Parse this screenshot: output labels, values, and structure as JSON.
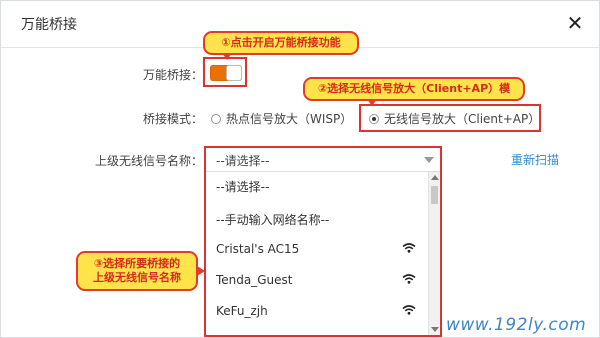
{
  "dialog": {
    "title": "万能桥接",
    "close_glyph": "✕"
  },
  "form": {
    "bridge_label": "万能桥接：",
    "mode_label": "桥接模式：",
    "mode_options": [
      {
        "label": "热点信号放大（WISP）",
        "checked": false
      },
      {
        "label": "无线信号放大（Client+AP）",
        "checked": true
      }
    ],
    "upstream_label": "上级无线信号名称：",
    "select_value": "--请选择--",
    "rescan_label": "重新扫描"
  },
  "dropdown": {
    "options": [
      {
        "label": "--请选择--",
        "wifi": false
      },
      {
        "label": "--手动输入网络名称--",
        "wifi": false
      },
      {
        "label": "Cristal's AC15",
        "wifi": true
      },
      {
        "label": "Tenda_Guest",
        "wifi": true
      },
      {
        "label": "KeFu_zjh",
        "wifi": true
      }
    ]
  },
  "annotations": {
    "step1": "①点击开启万能桥接功能",
    "step2": "②选择无线信号放大（Client+AP）模",
    "step3_line1": "③选择所要桥接的",
    "step3_line2": "上级无线信号名称"
  },
  "watermark": "www.192ly.com",
  "colors": {
    "accent_orange": "#e8710a",
    "highlight_red": "#dd3333",
    "link_blue": "#2f8bd0",
    "callout_yellow": "#ffe34a"
  }
}
